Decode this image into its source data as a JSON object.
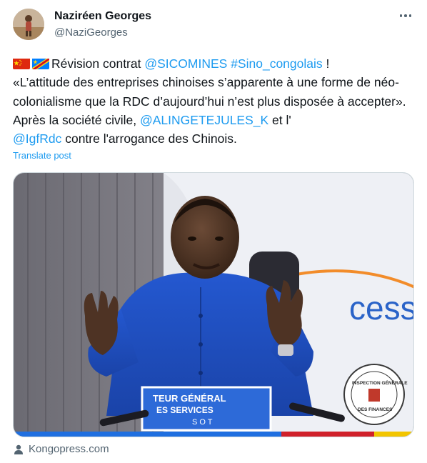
{
  "author": {
    "display_name": "Naziréen Georges",
    "handle": "@NaziGeorges"
  },
  "post": {
    "line1_pre": "Révision contrat ",
    "mention_sicomines": "@SICOMINES",
    "hashtag": "#Sino_congolais",
    "line1_post": " !",
    "body": "«L’attitude des entreprises chinoises s’apparente à une forme de néo-colonialisme que la RDC d’aujourd’hui n’est plus disposée à accepter». Après la société civile, ",
    "mention_alingete": "@ALINGETEJULES_K",
    "between": " et l' ",
    "mention_igf": "@IgfRdc",
    "tail": " contre l'arrogance des Chinois."
  },
  "translate_label": "Translate post",
  "media": {
    "backdrop_text": "cess",
    "nameplate_line1": "TEUR GÉNÉRAL",
    "nameplate_line2": "ES SERVICES",
    "nameplate_line3": "S O T",
    "seal_lines": [
      "INSPECTION GÉNÉRALE",
      "DES FINANCES"
    ]
  },
  "source": {
    "label": "Kongopress.com"
  },
  "colors": {
    "link": "#1d9bf0",
    "secondary": "#536471",
    "suit": "#1e4fc0",
    "flag_red": "#de2910",
    "flag_drc_blue": "#007fff"
  }
}
